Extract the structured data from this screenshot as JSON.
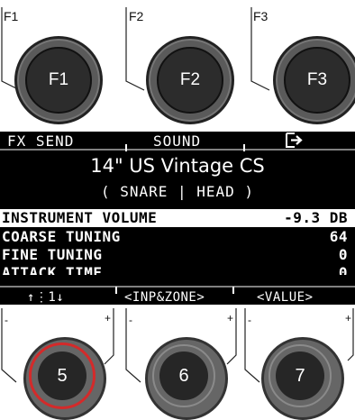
{
  "function_buttons": [
    {
      "corner_label": "F1",
      "cap_label": "F1"
    },
    {
      "corner_label": "F2",
      "cap_label": "F2"
    },
    {
      "corner_label": "F3",
      "cap_label": "F3"
    }
  ],
  "display": {
    "tabs": [
      "FX SEND",
      "SOUND"
    ],
    "exit_icon": "exit-arrow-icon",
    "title": "14\" US Vintage CS",
    "subtitle": "( SNARE | HEAD )",
    "params": [
      {
        "name": "INSTRUMENT VOLUME",
        "value": "-9.3 DB",
        "selected": true
      },
      {
        "name": "COARSE TUNING",
        "value": "64",
        "selected": false
      },
      {
        "name": "FINE TUNING",
        "value": "0",
        "selected": false
      },
      {
        "name": "ATTACK TIME",
        "value": "0",
        "selected": false
      }
    ],
    "bottom": {
      "nav": "↑⋮1↓",
      "inp_zone": "<INP&ZONE>",
      "value": "<VALUE>"
    }
  },
  "knobs": [
    {
      "label": "5",
      "minus": "-",
      "plus": "+",
      "active": true
    },
    {
      "label": "6",
      "minus": "-",
      "plus": "+",
      "active": false
    },
    {
      "label": "7",
      "minus": "-",
      "plus": "+",
      "active": false
    }
  ],
  "colors": {
    "active_ring": "#d42a2a",
    "display_bg": "#000000",
    "button_body": "#5a5a5a"
  }
}
